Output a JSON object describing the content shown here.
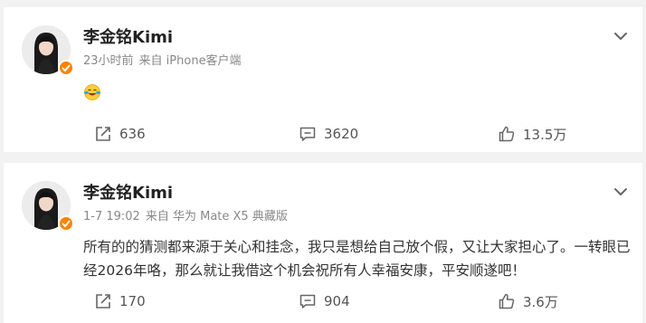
{
  "posts": [
    {
      "username": "李金铭Kimi",
      "time": "23小时前",
      "source": "来自 iPhone客户端",
      "text": "",
      "reposts": "636",
      "comments": "3620",
      "likes": "13.5万",
      "emoji_icon": "laughing-crying-emoji-icon"
    },
    {
      "username": "李金铭Kimi",
      "time": "1-7 19:02",
      "source": "来自 华为 Mate X5 典藏版",
      "text": "所有的的猜测都来源于关心和挂念，我只是想给自己放个假，又让大家担心了。一转眼已经2026年咯，那么就让我借这个机会祝所有人幸福安康，平安顺遂吧！",
      "reposts": "170",
      "comments": "904",
      "likes": "3.6万"
    }
  ],
  "colors": {
    "verified_badge": "#ff8200",
    "background": "#f2f2f2",
    "card": "#ffffff"
  }
}
